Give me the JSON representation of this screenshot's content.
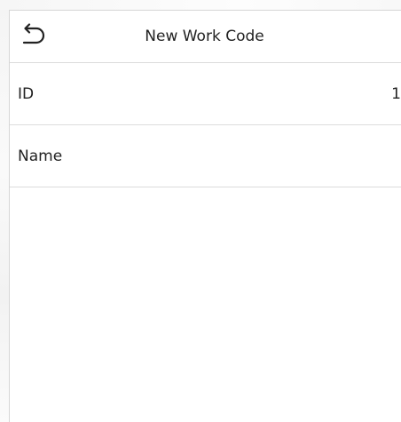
{
  "header": {
    "title": "New Work Code",
    "back_icon": "back-arrow-icon"
  },
  "fields": [
    {
      "label": "ID",
      "value": "1"
    },
    {
      "label": "Name",
      "value": ""
    }
  ],
  "colors": {
    "background": "#ffffff",
    "text": "#222222",
    "divider": "#dcdcdc"
  }
}
